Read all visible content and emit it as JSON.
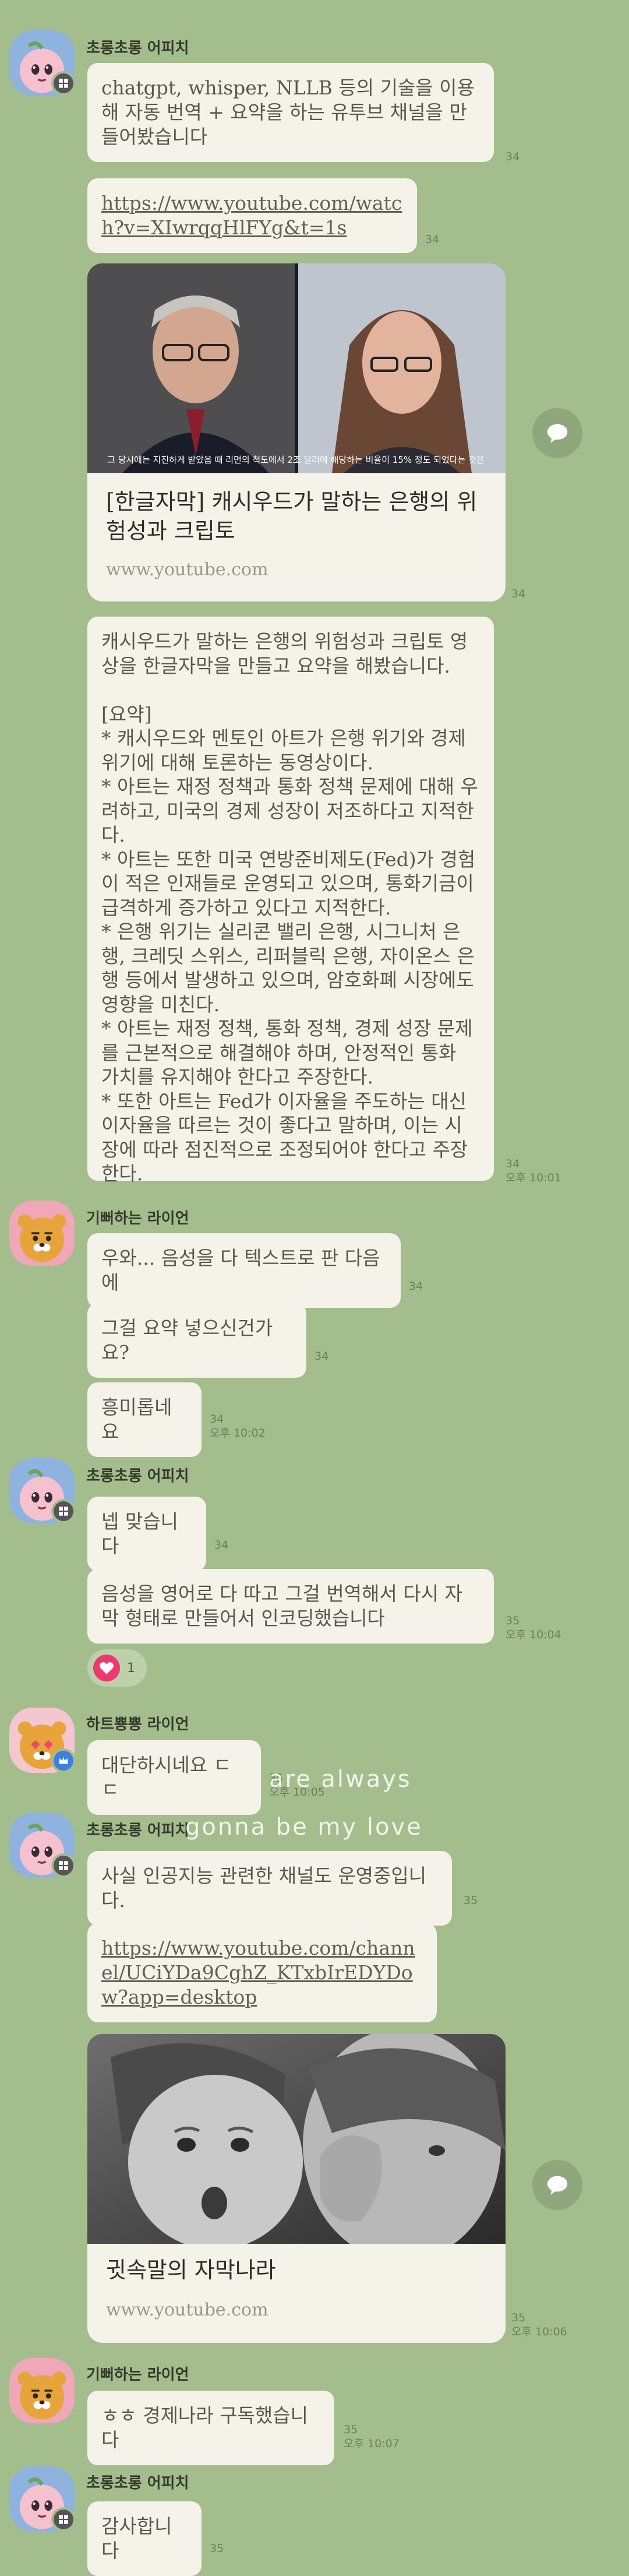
{
  "colors": {
    "background": "#a4bd8d",
    "bubble": "#f5f2e9",
    "heart": "#f03870"
  },
  "senders": {
    "apeach": "초롱초롱 어피치",
    "ryan": "기뻐하는 라이언",
    "ryan_heart": "하트뿅뿅 라이언"
  },
  "messages": {
    "m1": "chatgpt, whisper, NLLB 등의 기술을 이용해 자동 번역 + 요약을 하는 유투브 채널을 만들어봤습니다",
    "m1_unread": "34",
    "m2": "https://www.youtube.com/watch?v=XIwrqqHlFYg&t=1s",
    "m2_unread": "34",
    "card1_caption": "그 당시에는 지진하게 받았음 때 리먼의 척도에서 2조 달러에 해당하는 비율이 15% 정도 되었다는 것은",
    "card1_title": "[한글자막] 캐시우드가 말하는 은행의 위험성과 크립토",
    "card1_domain": "www.youtube.com",
    "card1_unread": "34",
    "m3": "캐시우드가 말하는 은행의 위험성과 크립토 영상을 한글자막을 만들고 요약을 해봤습니다.\n\n[요약]\n* 캐시우드와 멘토인 아트가 은행 위기와 경제 위기에 대해 토론하는 동영상이다.\n* 아트는 재정 정책과 통화 정책 문제에 대해 우려하고, 미국의 경제 성장이 저조하다고 지적한다.\n* 아트는 또한 미국 연방준비제도(Fed)가 경험이 적은 인재들로 운영되고 있으며, 통화기금이 급격하게 증가하고 있다고 지적한다.\n* 은행 위기는 실리콘 밸리 은행, 시그니처 은행, 크레딧 스위스, 리퍼블릭 은행, 자이온스 은행 등에서 발생하고 있으며, 암호화폐 시장에도 영향을 미친다.\n* 아트는 재정 정책, 통화 정책, 경제 성장 문제를 근본적으로 해결해야 하며, 안정적인 통화 가치를 유지해야 한다고 주장한다.\n* 또한 아트는 Fed가 이자율을 주도하는 대신 이자율을 따르는 것이 좋다고 말하며, 이는 시장에 따라 점진적으로 조정되어야 한다고 주장한다.",
    "m3_unread": "34",
    "m3_time": "오후 10:01",
    "r1": "우와... 음성을 다 텍스트로 판 다음에",
    "r1_unread": "34",
    "r2": "그걸 요약 넣으신건가요?",
    "r2_unread": "34",
    "r3": "흥미롭네요",
    "r3_unread": "34",
    "r3_time": "오후 10:02",
    "a1": "넵 맞습니다",
    "a1_unread": "34",
    "a2": "음성을 영어로 다 따고 그걸 번역해서 다시 자막 형태로 만들어서 인코딩했습니다",
    "a2_unread": "35",
    "a2_time": "오후 10:04",
    "reaction_count": "1",
    "h1": "대단하시네요 ㄷㄷ",
    "h1_unread": "35",
    "h1_time": "오후 10:05",
    "overlay1": "are always",
    "overlay2": "gonna be my love",
    "a3": "사실 인공지능 관련한 채널도 운영중입니다.",
    "a3_unread": "35",
    "a4": "https://www.youtube.com/channel/UCiYDa9CghZ_KTxbIrEDYDow?app=desktop",
    "card2_title": "귓속말의 자막나라",
    "card2_domain": "www.youtube.com",
    "card2_unread": "35",
    "card2_time": "오후 10:06",
    "r4": "ㅎㅎ 경제나라 구독했습니다",
    "r4_unread": "35",
    "r4_time": "오후 10:07",
    "a5": "감사합니다",
    "a5_unread": "35"
  }
}
